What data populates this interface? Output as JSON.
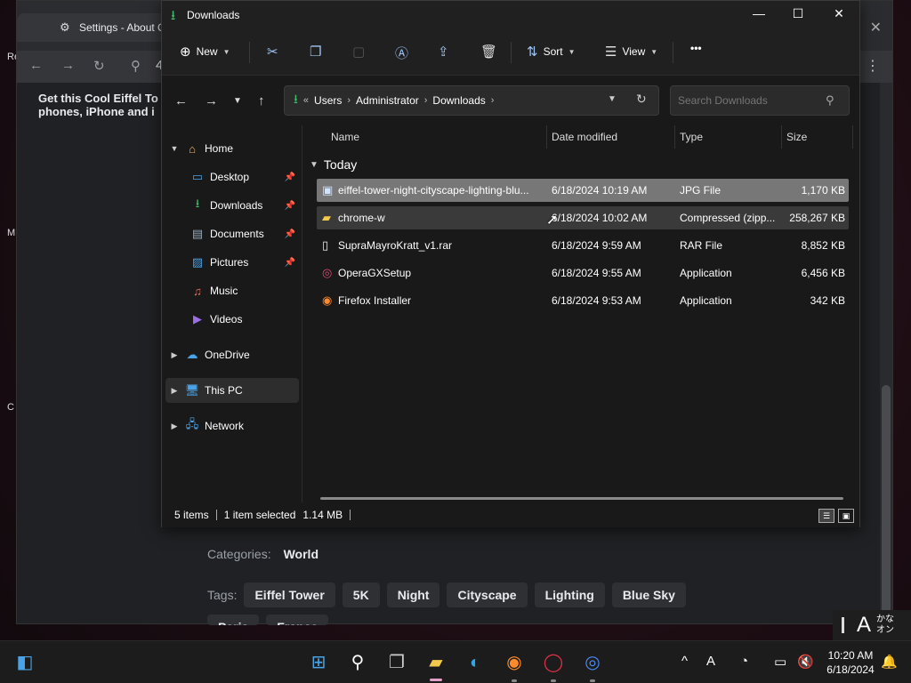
{
  "desktop": {
    "glyphs": [
      "Re",
      "M",
      "C"
    ]
  },
  "browser": {
    "tab_title": "Settings - About C",
    "address_fragment": "4",
    "page_heading_line1": "Get this Cool Eiffel To",
    "page_heading_line2": "phones, iPhone and i",
    "categories_label": "Categories:",
    "categories_value": "World",
    "tags_label": "Tags:",
    "tags": [
      "Eiffel Tower",
      "5K",
      "Night",
      "Cityscape",
      "Lighting",
      "Blue Sky"
    ],
    "tags_row2": [
      "Paris",
      "France"
    ]
  },
  "explorer": {
    "title": "Downloads",
    "commandbar": {
      "new_label": "New",
      "sort_label": "Sort",
      "view_label": "View",
      "more_label": "•••"
    },
    "address": {
      "more": "«",
      "crumbs": [
        "Users",
        "Administrator",
        "Downloads"
      ]
    },
    "search_placeholder": "Search Downloads",
    "nav": {
      "home": "Home",
      "desktop": "Desktop",
      "downloads": "Downloads",
      "documents": "Documents",
      "pictures": "Pictures",
      "music": "Music",
      "videos": "Videos",
      "onedrive": "OneDrive",
      "thispc": "This PC",
      "network": "Network"
    },
    "columns": {
      "name": "Name",
      "date": "Date modified",
      "type": "Type",
      "size": "Size"
    },
    "group": "Today",
    "files": [
      {
        "name": "eiffel-tower-night-cityscape-lighting-blu...",
        "date": "6/18/2024 10:19 AM",
        "type": "JPG File",
        "size": "1,170 KB",
        "icon": "image-file-icon"
      },
      {
        "name": "chrome-w",
        "date": "6/18/2024 10:02 AM",
        "type": "Compressed (zipp...",
        "size": "258,267 KB",
        "icon": "zip-folder-icon"
      },
      {
        "name": "SupraMayroKratt_v1.rar",
        "date": "6/18/2024 9:59 AM",
        "type": "RAR File",
        "size": "8,852 KB",
        "icon": "file-icon"
      },
      {
        "name": "OperaGXSetup",
        "date": "6/18/2024 9:55 AM",
        "type": "Application",
        "size": "6,456 KB",
        "icon": "opera-gx-icon"
      },
      {
        "name": "Firefox Installer",
        "date": "6/18/2024 9:53 AM",
        "type": "Application",
        "size": "342 KB",
        "icon": "firefox-icon"
      }
    ],
    "status": {
      "items": "5 items",
      "selected": "1 item selected",
      "size": "1.14 MB"
    }
  },
  "ime": {
    "mode": "A",
    "kana_line1": "かな",
    "kana_line2": "オン"
  },
  "taskbar": {
    "time": "10:20 AM",
    "date": "6/18/2024"
  },
  "colors": {
    "selected_row": "#777777",
    "accent_green": "#3fbf6a",
    "taskbar_bg": "#1c1c1c"
  }
}
